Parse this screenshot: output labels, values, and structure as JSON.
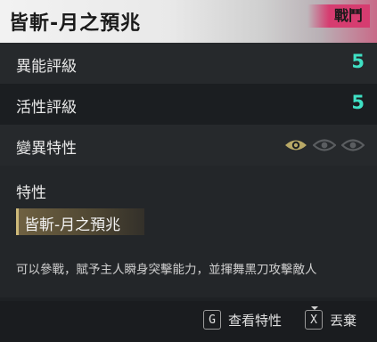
{
  "header": {
    "title": "皆斬-月之預兆",
    "badge": "戰鬥",
    "badge_color": "#d63c70"
  },
  "stats": [
    {
      "label": "異能評級",
      "value": "5"
    },
    {
      "label": "活性評級",
      "value": "5"
    }
  ],
  "mutation": {
    "label": "變異特性",
    "eyes_total": 3,
    "eyes_active": 1,
    "eye_icon": "eye-icon",
    "active_color": "#b8a866",
    "inactive_color": "#5a5d60"
  },
  "trait": {
    "heading": "特性",
    "name": "皆斬-月之預兆",
    "description": "可以參戰，賦予主人瞬身突擊能力，並揮舞黑刀攻擊敵人"
  },
  "footer": {
    "actions": [
      {
        "key": "G",
        "label": "查看特性"
      },
      {
        "key": "X",
        "label": "丟棄"
      }
    ]
  },
  "colors": {
    "accent_value": "#3fe0c4"
  }
}
